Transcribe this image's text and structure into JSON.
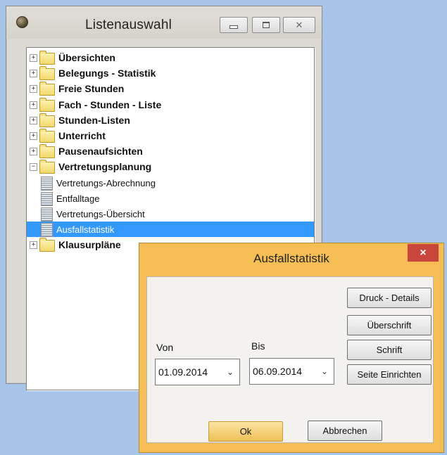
{
  "main_window": {
    "title": "Listenauswahl",
    "tree": [
      {
        "label": "Übersichten",
        "type": "folder",
        "expander": "+"
      },
      {
        "label": "Belegungs - Statistik",
        "type": "folder",
        "expander": "+"
      },
      {
        "label": "Freie Stunden",
        "type": "folder",
        "expander": "+"
      },
      {
        "label": "Fach - Stunden - Liste",
        "type": "folder",
        "expander": "+"
      },
      {
        "label": "Stunden-Listen",
        "type": "folder",
        "expander": "+"
      },
      {
        "label": "Unterricht",
        "type": "folder",
        "expander": "+"
      },
      {
        "label": "Pausenaufsichten",
        "type": "folder",
        "expander": "+"
      },
      {
        "label": "Vertretungsplanung",
        "type": "folder",
        "expander": "−"
      },
      {
        "label": "Vertretungs-Abrechnung",
        "type": "item"
      },
      {
        "label": "Entfalltage",
        "type": "item"
      },
      {
        "label": "Vertretungs-Übersicht",
        "type": "item"
      },
      {
        "label": "Ausfallstatistik",
        "type": "item",
        "selected": true
      },
      {
        "label": "Klausurpläne",
        "type": "folder",
        "expander": "+"
      }
    ]
  },
  "dialog": {
    "title": "Ausfallstatistik",
    "close_glyph": "×",
    "von_label": "Von",
    "bis_label": "Bis",
    "von_value": "01.09.2014",
    "bis_value": "06.09.2014",
    "combo_arrow": "⌄",
    "buttons": {
      "druck_details": "Druck - Details",
      "ueberschrift": "Überschrift",
      "schrift": "Schrift",
      "seite_einrichten": "Seite Einrichten",
      "ok": "Ok",
      "abbrechen": "Abbrechen"
    }
  },
  "colors": {
    "desktop": "#a7c5e8",
    "selection": "#3399ff",
    "dialog_frame": "#f4be55",
    "close_button": "#c9463d"
  }
}
